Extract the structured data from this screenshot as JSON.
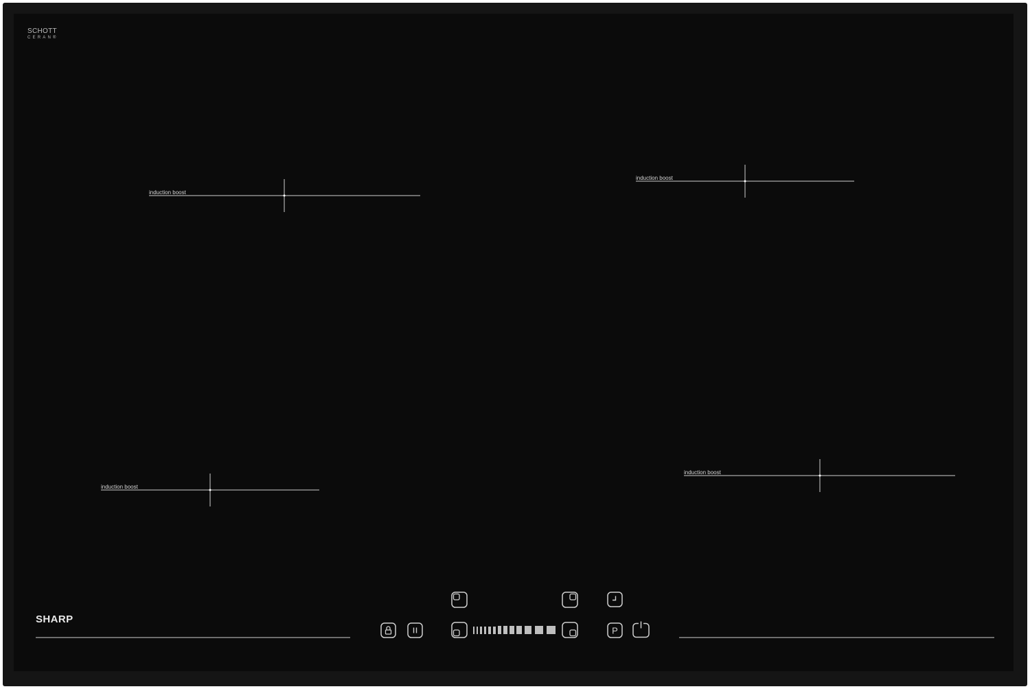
{
  "hob": {
    "brand_top": {
      "line1": "SCHOTT",
      "line2": "CERAN®"
    },
    "maker": "SHARP",
    "zones": [
      {
        "id": "rear-left",
        "label": "induction boost"
      },
      {
        "id": "rear-right",
        "label": "induction boost"
      },
      {
        "id": "front-left",
        "label": "induction boost"
      },
      {
        "id": "front-right",
        "label": "induction boost"
      }
    ],
    "controls": [
      {
        "name": "lock-icon"
      },
      {
        "name": "pause-icon"
      },
      {
        "name": "zone-rear-left-icon"
      },
      {
        "name": "zone-front-left-icon"
      },
      {
        "name": "power-slider"
      },
      {
        "name": "zone-rear-right-icon"
      },
      {
        "name": "zone-front-right-icon"
      },
      {
        "name": "timer-icon"
      },
      {
        "name": "boost-p-icon"
      },
      {
        "name": "power-icon"
      }
    ],
    "boost_key_label": "P",
    "colors": {
      "glass": "#0b0b0b",
      "frame": "#151515",
      "print": "#d8d8d8"
    }
  }
}
